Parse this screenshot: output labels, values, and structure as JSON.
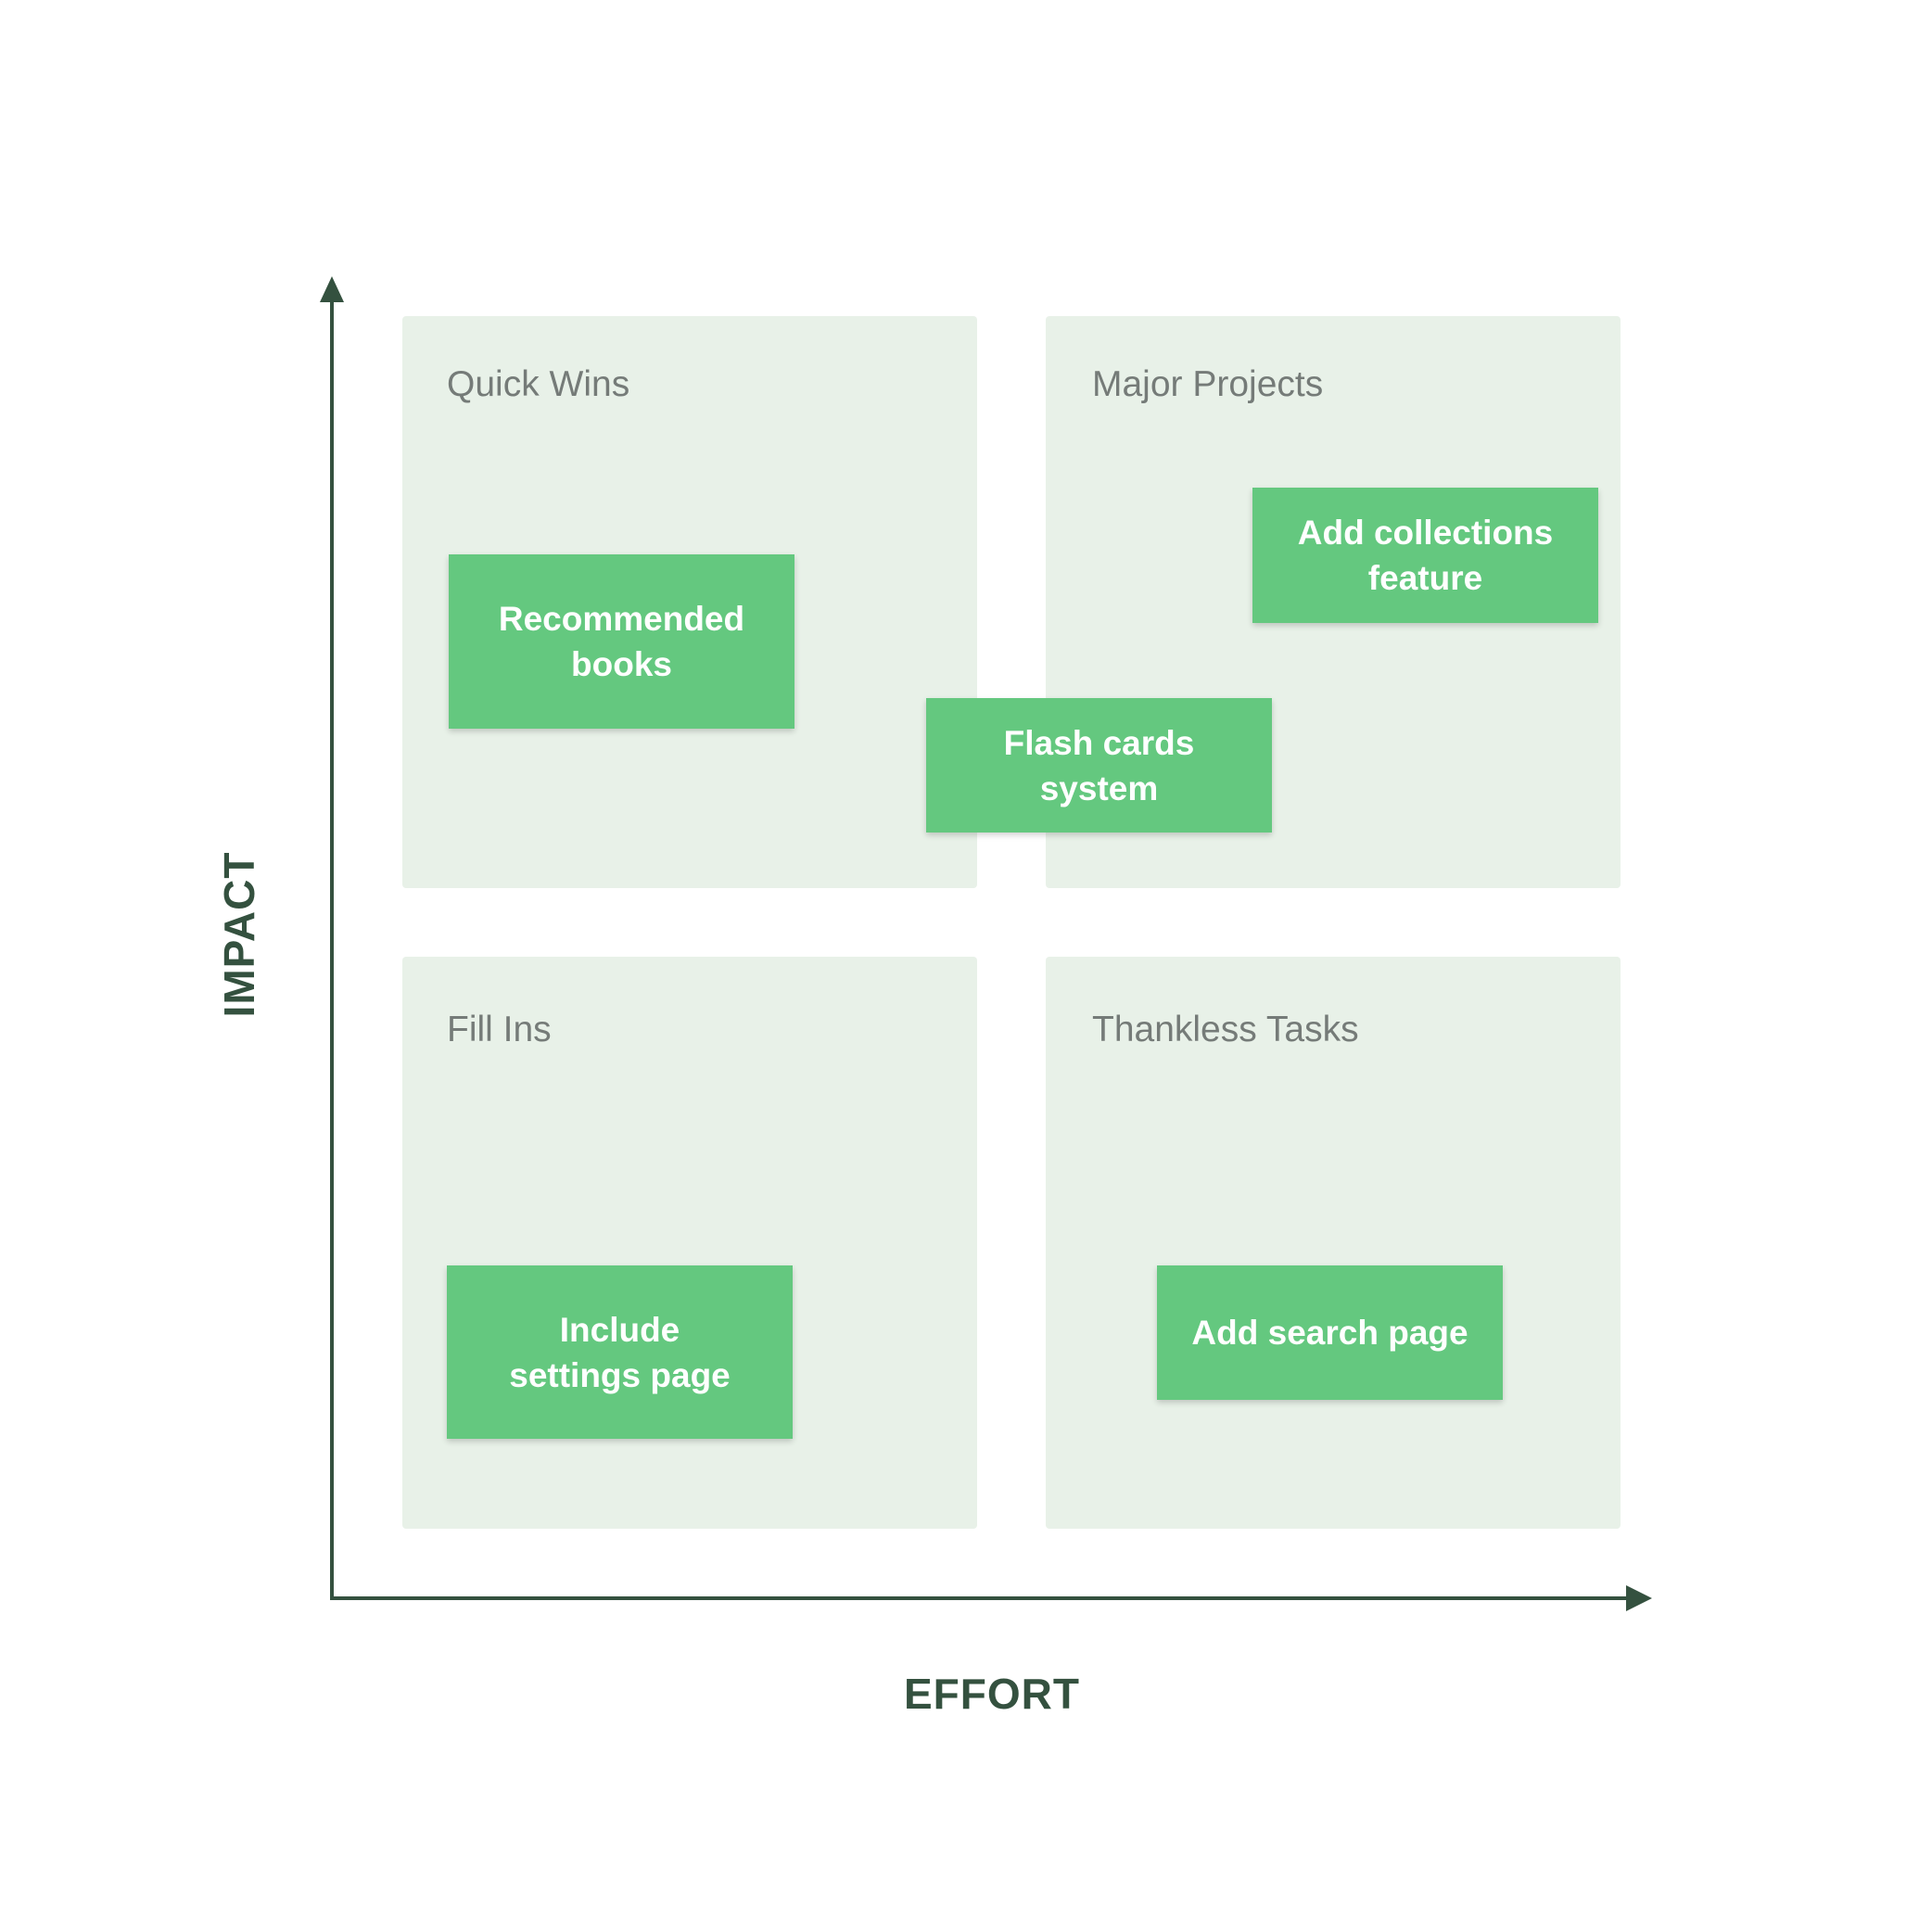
{
  "axes": {
    "x_label": "EFFORT",
    "y_label": "IMPACT",
    "color": "#34513f"
  },
  "quadrants": [
    {
      "label": "Quick Wins"
    },
    {
      "label": "Major Projects"
    },
    {
      "label": "Fill Ins"
    },
    {
      "label": "Thankless Tasks"
    }
  ],
  "cards": [
    {
      "text": "Recommended books"
    },
    {
      "text": "Add collections feature"
    },
    {
      "text": "Flash cards system"
    },
    {
      "text": "Include settings page"
    },
    {
      "text": "Add search page"
    }
  ],
  "colors": {
    "quadrant_fill": "#e8f1e8",
    "card_fill": "#64c87f",
    "card_text": "#ffffff",
    "quadrant_label": "#757b78"
  }
}
